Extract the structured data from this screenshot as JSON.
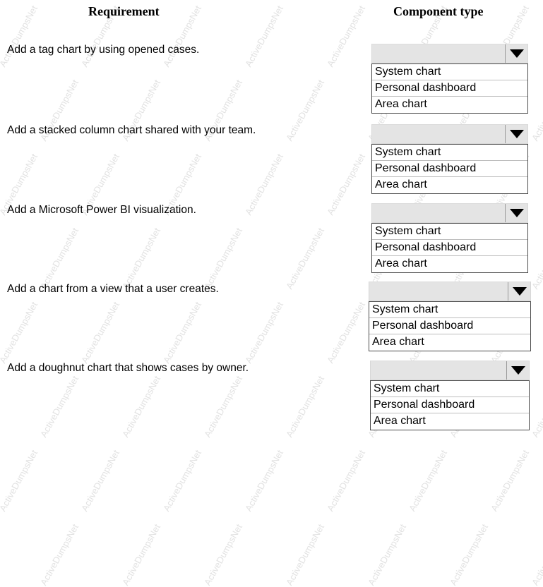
{
  "header": {
    "requirement_label": "Requirement",
    "component_type_label": "Component type"
  },
  "watermark": {
    "text": "ActiveDumpsNet",
    "color": "#e2e2e2"
  },
  "colors": {
    "combo_background": "#e4e4e4",
    "combo_border": "#d8d8d8",
    "list_border": "#4a4a4a",
    "option_separator": "#bdbdbd",
    "arrow": "#000000",
    "text": "#000000",
    "page_background": "#ffffff"
  },
  "dropdown_options": [
    "System chart",
    "Personal dashboard",
    "Area chart"
  ],
  "rows": [
    {
      "requirement": "Add a tag chart by using opened cases.",
      "selected_value": "",
      "options": [
        "System chart",
        "Personal dashboard",
        "Area chart"
      ]
    },
    {
      "requirement": "Add a stacked column chart shared with your team.",
      "selected_value": "",
      "options": [
        "System chart",
        "Personal dashboard",
        "Area chart"
      ]
    },
    {
      "requirement": "Add a Microsoft Power BI visualization.",
      "selected_value": "",
      "options": [
        "System chart",
        "Personal dashboard",
        "Area chart"
      ]
    },
    {
      "requirement": "Add a chart from a view that a user creates.",
      "selected_value": "",
      "options": [
        "System chart",
        "Personal dashboard",
        "Area chart"
      ]
    },
    {
      "requirement": "Add a doughnut chart that shows cases by owner.",
      "selected_value": "",
      "options": [
        "System chart",
        "Personal dashboard",
        "Area chart"
      ]
    }
  ],
  "icons": {
    "dropdown_arrow": "chevron-down-icon"
  }
}
